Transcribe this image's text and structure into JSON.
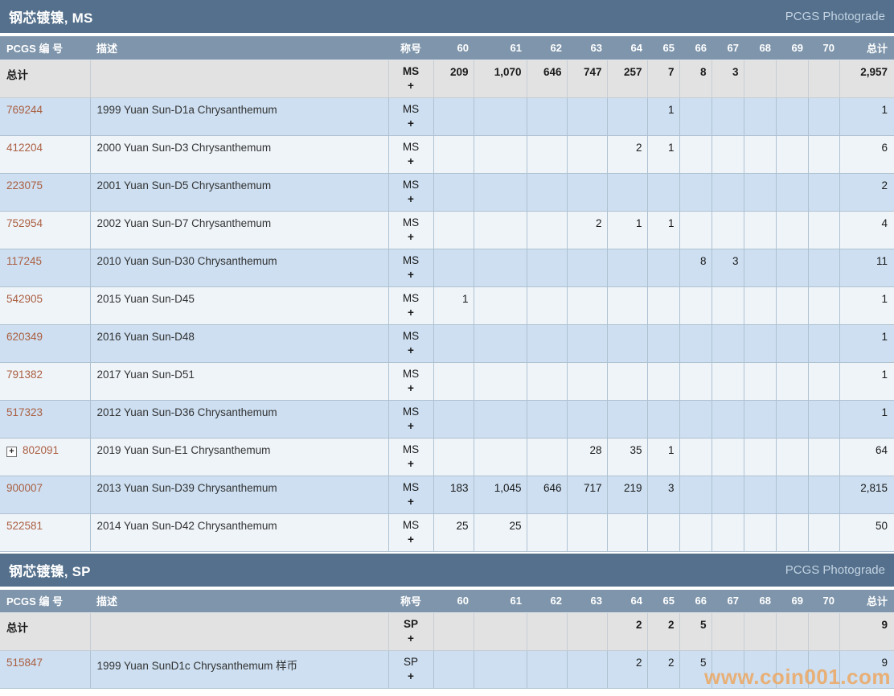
{
  "photograde_label": "PCGS Photograde",
  "watermark": "www.coin001.com",
  "colors": {
    "section_header_bg": "#54708c",
    "column_header_bg": "#7e95ab",
    "row_blue": "#cddff1",
    "row_light": "#eff4f9",
    "totals_row_bg": "#e2e2e2",
    "link": "#ab5f41",
    "watermark": "#efa55c"
  },
  "columns": {
    "pcgs_number": "PCGS 编 号",
    "description": "描述",
    "designation": "称号",
    "grades": [
      "60",
      "61",
      "62",
      "63",
      "64",
      "65",
      "66",
      "67",
      "68",
      "69",
      "70"
    ],
    "total": "总计"
  },
  "sections": [
    {
      "title": "钢芯镀镍, MS",
      "totals_row": {
        "label": "总计",
        "designation": "MS",
        "designation_suffix": "+",
        "grades": {
          "60": "209",
          "61": "1,070",
          "62": "646",
          "63": "747",
          "64": "257",
          "65": "7",
          "66": "8",
          "67": "3"
        },
        "total": "2,957"
      },
      "rows": [
        {
          "pcgs_number": "769244",
          "expandable": false,
          "description": "1999 Yuan Sun-D1a Chrysanthemum",
          "designation": "MS",
          "designation_suffix": "+",
          "grades": {
            "65": "1"
          },
          "total": "1"
        },
        {
          "pcgs_number": "412204",
          "expandable": false,
          "description": "2000 Yuan Sun-D3 Chrysanthemum",
          "designation": "MS",
          "designation_suffix": "+",
          "grades": {
            "64": "2",
            "65": "1"
          },
          "total": "6"
        },
        {
          "pcgs_number": "223075",
          "expandable": false,
          "description": "2001 Yuan Sun-D5 Chrysanthemum",
          "designation": "MS",
          "designation_suffix": "+",
          "grades": {},
          "total": "2"
        },
        {
          "pcgs_number": "752954",
          "expandable": false,
          "description": "2002 Yuan Sun-D7 Chrysanthemum",
          "designation": "MS",
          "designation_suffix": "+",
          "grades": {
            "63": "2",
            "64": "1",
            "65": "1"
          },
          "total": "4"
        },
        {
          "pcgs_number": "117245",
          "expandable": false,
          "description": "2010 Yuan Sun-D30 Chrysanthemum",
          "designation": "MS",
          "designation_suffix": "+",
          "grades": {
            "66": "8",
            "67": "3"
          },
          "total": "11"
        },
        {
          "pcgs_number": "542905",
          "expandable": false,
          "description": "2015 Yuan Sun-D45",
          "designation": "MS",
          "designation_suffix": "+",
          "grades": {
            "60": "1"
          },
          "total": "1"
        },
        {
          "pcgs_number": "620349",
          "expandable": false,
          "description": "2016 Yuan Sun-D48",
          "designation": "MS",
          "designation_suffix": "+",
          "grades": {},
          "total": "1"
        },
        {
          "pcgs_number": "791382",
          "expandable": false,
          "description": "2017 Yuan Sun-D51",
          "designation": "MS",
          "designation_suffix": "+",
          "grades": {},
          "total": "1"
        },
        {
          "pcgs_number": "517323",
          "expandable": false,
          "description": "2012 Yuan Sun-D36 Chrysanthemum",
          "designation": "MS",
          "designation_suffix": "+",
          "grades": {},
          "total": "1"
        },
        {
          "pcgs_number": "802091",
          "expandable": true,
          "description": "2019 Yuan Sun-E1 Chrysanthemum",
          "designation": "MS",
          "designation_suffix": "+",
          "grades": {
            "63": "28",
            "64": "35",
            "65": "1"
          },
          "total": "64"
        },
        {
          "pcgs_number": "900007",
          "expandable": false,
          "description": "2013 Yuan Sun-D39 Chrysanthemum",
          "designation": "MS",
          "designation_suffix": "+",
          "grades": {
            "60": "183",
            "61": "1,045",
            "62": "646",
            "63": "717",
            "64": "219",
            "65": "3"
          },
          "total": "2,815"
        },
        {
          "pcgs_number": "522581",
          "expandable": false,
          "description": "2014 Yuan Sun-D42 Chrysanthemum",
          "designation": "MS",
          "designation_suffix": "+",
          "grades": {
            "60": "25",
            "61": "25"
          },
          "total": "50"
        }
      ]
    },
    {
      "title": "钢芯镀镍, SP",
      "totals_row": {
        "label": "总计",
        "designation": "SP",
        "designation_suffix": "+",
        "grades": {
          "64": "2",
          "65": "2",
          "66": "5"
        },
        "total": "9"
      },
      "rows": [
        {
          "pcgs_number": "515847",
          "expandable": false,
          "description": "1999 Yuan SunD1c Chrysanthemum 样币",
          "designation": "SP",
          "designation_suffix": "+",
          "grades": {
            "64": "2",
            "65": "2",
            "66": "5"
          },
          "total": "9"
        }
      ]
    }
  ]
}
